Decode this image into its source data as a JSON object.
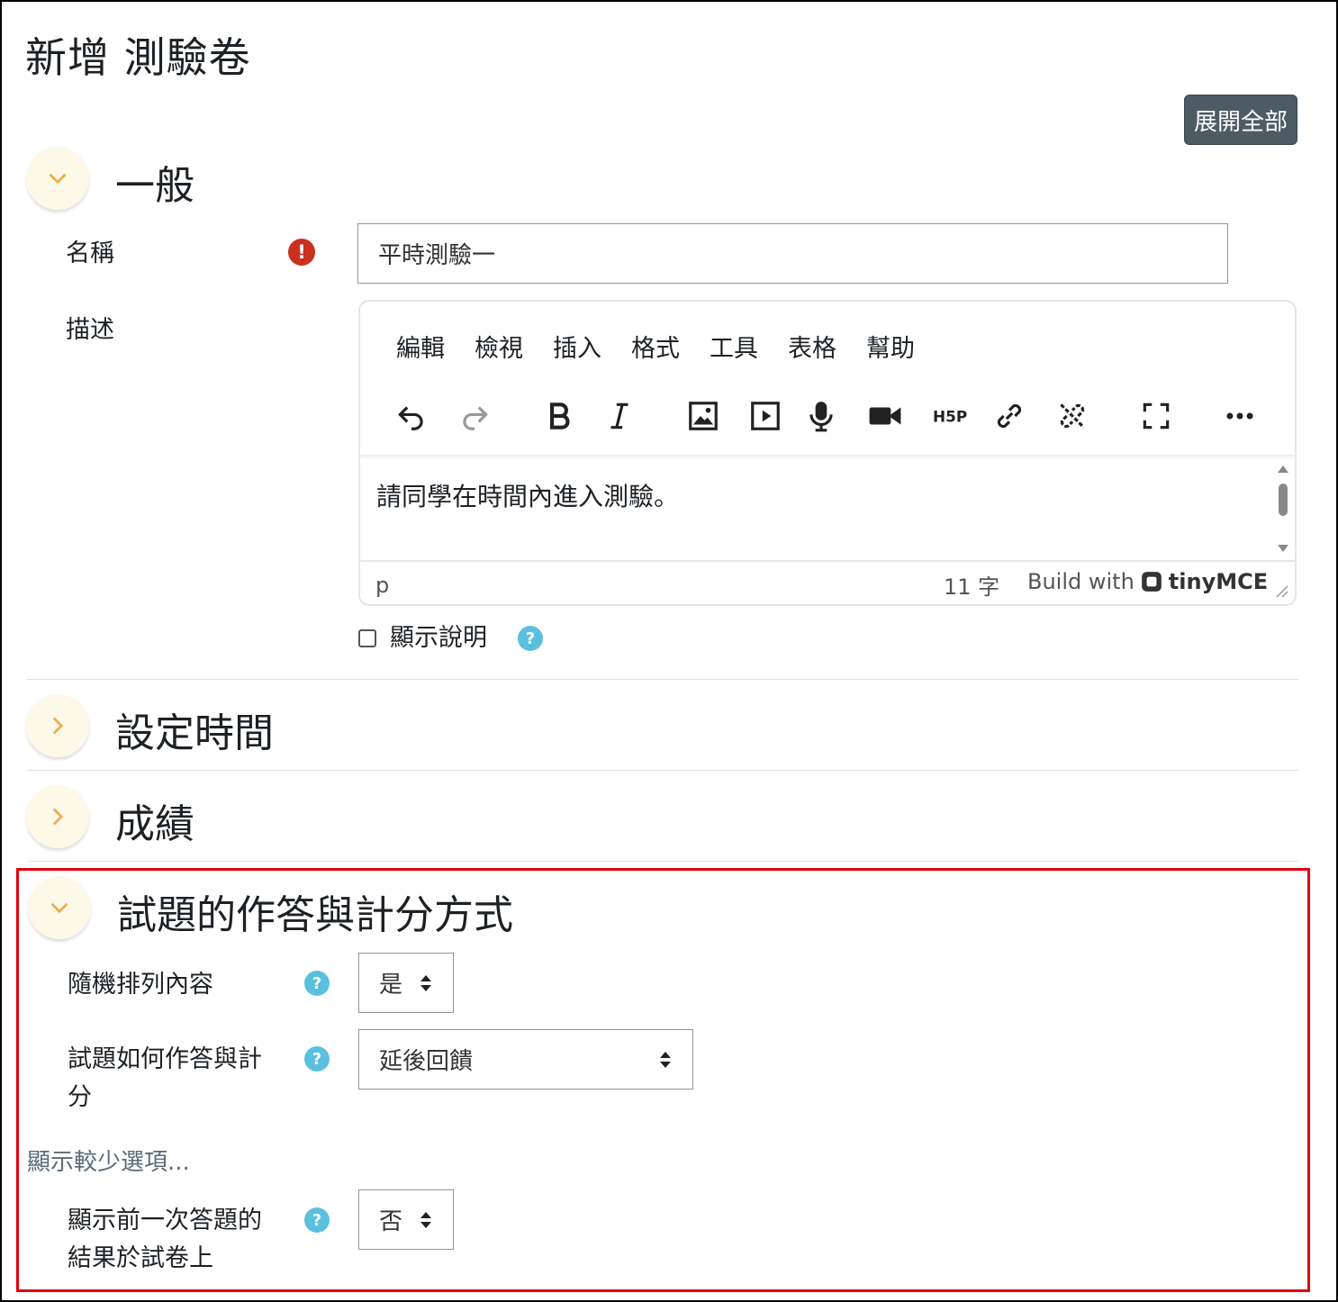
{
  "page": {
    "title": "新增 測驗卷",
    "expand_all": "展開全部"
  },
  "general": {
    "title": "一般",
    "name_label": "名稱",
    "name_value": "平時測驗一",
    "description_label": "描述",
    "editor": {
      "menu": [
        "編輯",
        "檢視",
        "插入",
        "格式",
        "工具",
        "表格",
        "幫助"
      ],
      "content": "請同學在時間內進入測驗。",
      "status_path": "p",
      "word_count": "11 字",
      "build_with": "Build with",
      "brand": "tinyMCE"
    },
    "show_description_label": "顯示說明"
  },
  "sections": {
    "timing": "設定時間",
    "grade": "成績",
    "question_behaviour": "試題的作答與計分方式"
  },
  "question_behaviour": {
    "shuffle_label": "隨機排列內容",
    "shuffle_value": "是",
    "how_behave_label_1": "試題如何作答與計",
    "how_behave_label_2": "分",
    "how_behave_value": "延後回饋",
    "show_less": "顯示較少選項...",
    "each_attempt_label_1": "顯示前一次答題的",
    "each_attempt_label_2": "結果於試卷上",
    "each_attempt_value": "否"
  },
  "icons": {
    "required": "!",
    "help": "?",
    "chevron_color": "#f0ad4e",
    "help_color": "#5bc0de",
    "required_color": "#ca3120",
    "highlight_color": "#e3000f"
  }
}
